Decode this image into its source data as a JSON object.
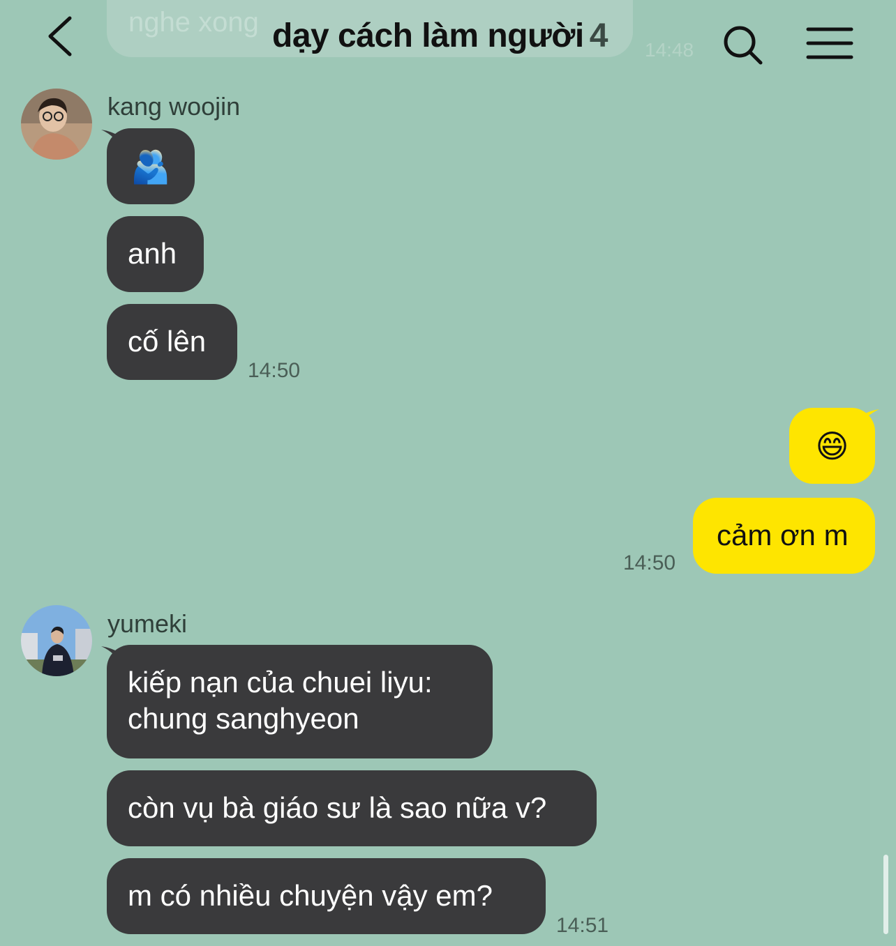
{
  "header": {
    "title": "dạy cách làm người",
    "member_count": "4",
    "back_icon": "chevron-left-icon",
    "search_icon": "search-icon",
    "menu_icon": "hamburger-menu-icon"
  },
  "previous_message": {
    "text": "nghe xong",
    "time": "14:48"
  },
  "groups": [
    {
      "sender": "kang woojin",
      "messages": [
        "🫂",
        "anh",
        "cố lên"
      ],
      "time": "14:50"
    },
    {
      "sender": "me",
      "messages": [
        "😄",
        "cảm ơn m"
      ],
      "time": "14:50"
    },
    {
      "sender": "yumeki",
      "messages": [
        "kiếp nạn của chuei liyu:",
        "chung sanghyeon",
        "còn vụ bà giáo sư là sao nữa v?",
        "m có nhiều chuyện vậy em?"
      ],
      "time": "14:51"
    }
  ],
  "colors": {
    "background": "#9dc7b6",
    "incoming_bubble": "#3a3a3c",
    "outgoing_bubble": "#fee500"
  }
}
